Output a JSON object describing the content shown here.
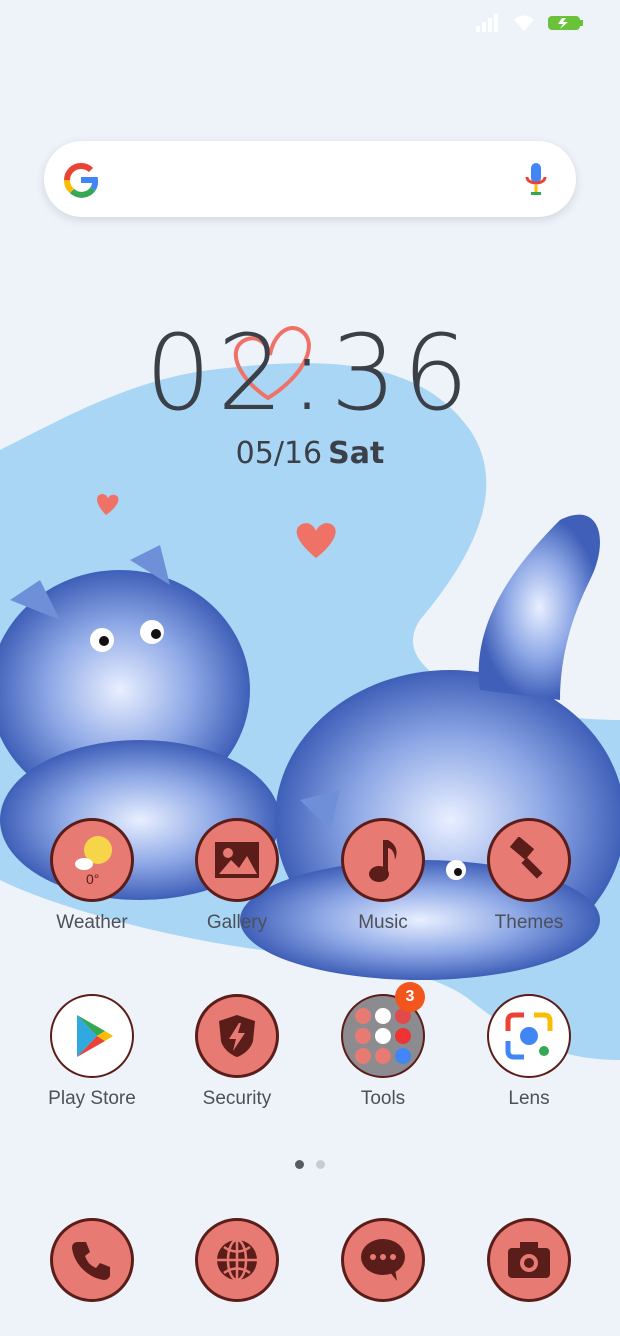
{
  "status": {
    "signal_icon": "signal-icon",
    "wifi_icon": "wifi-icon",
    "battery_icon": "battery-charging-icon"
  },
  "search": {
    "logo": "G",
    "mic_icon": "mic-icon"
  },
  "clock": {
    "time": "02:36",
    "date": "05/16",
    "day": "Sat"
  },
  "row1": [
    {
      "label": "Weather",
      "icon": "weather-icon",
      "temp": "0°"
    },
    {
      "label": "Gallery",
      "icon": "gallery-icon"
    },
    {
      "label": "Music",
      "icon": "music-icon"
    },
    {
      "label": "Themes",
      "icon": "themes-icon"
    }
  ],
  "row2": [
    {
      "label": "Play Store",
      "icon": "play-store-icon"
    },
    {
      "label": "Security",
      "icon": "security-icon"
    },
    {
      "label": "Tools",
      "icon": "tools-folder-icon",
      "badge": "3"
    },
    {
      "label": "Lens",
      "icon": "lens-icon"
    }
  ],
  "dock": [
    {
      "icon": "phone-icon"
    },
    {
      "icon": "browser-icon"
    },
    {
      "icon": "messages-icon"
    },
    {
      "icon": "camera-icon"
    }
  ],
  "pages": {
    "count": 2,
    "active": 1
  },
  "colors": {
    "accent": "#e77b73",
    "outline": "#5b1d1a",
    "blob": "#a9d6f5",
    "cat": "#5b7cd0"
  }
}
